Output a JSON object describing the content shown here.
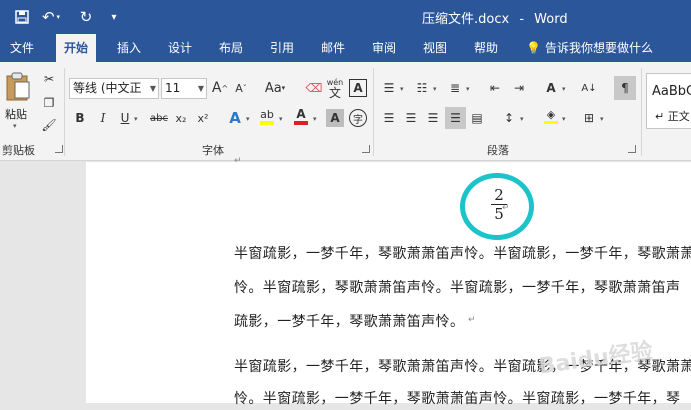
{
  "title_bar": {
    "doc_name": "压缩文件.docx",
    "separator": "-",
    "app_name": "Word"
  },
  "menu": {
    "tabs": [
      "文件",
      "开始",
      "插入",
      "设计",
      "布局",
      "引用",
      "邮件",
      "审阅",
      "视图",
      "帮助"
    ],
    "tell_me": "告诉我你想要做什么"
  },
  "ribbon": {
    "paste_label": "粘贴",
    "clipboard_label": "剪贴板",
    "font_name": "等线 (中文正",
    "font_size": "11",
    "font_group_label": "字体",
    "paragraph_group_label": "段落",
    "styles_preview": "AaBbC",
    "style_name": "正文",
    "char_A_grow": "A",
    "char_A_shrink": "A",
    "change_case": "Aa",
    "bold": "B",
    "italic": "I",
    "underline": "U",
    "strikethrough": "abc",
    "subscript": "x₂",
    "superscript": "x²",
    "phonetic_top": "wén",
    "phonetic_bottom": "文",
    "char_border": "A",
    "char_shading": "A",
    "enclose_char": "字"
  },
  "colors": {
    "accent": "#2b579a",
    "annotation_circle": "#1cc4c9",
    "font_color_bar": "#e02020",
    "highlight_bar": "#ffff00"
  },
  "document": {
    "fraction_numerator": "2",
    "fraction_denominator": "5",
    "lines": [
      "半窗疏影，一梦千年，琴歌萧萧笛声怜。半窗疏影，一梦千年，琴歌萧萧",
      "怜。半窗疏影，琴歌萧萧笛声怜。半窗疏影，一梦千年，琴歌萧萧笛声",
      "疏影，一梦千年，琴歌萧萧笛声怜。",
      "半窗疏影，一梦千年，琴歌萧萧笛声怜。半窗疏影，一梦千年，琴歌萧萧",
      "怜。半窗疏影，一梦千年，琴歌萧萧笛声怜。半窗疏影，一梦千年，琴"
    ]
  },
  "watermark": "Baidu经验"
}
